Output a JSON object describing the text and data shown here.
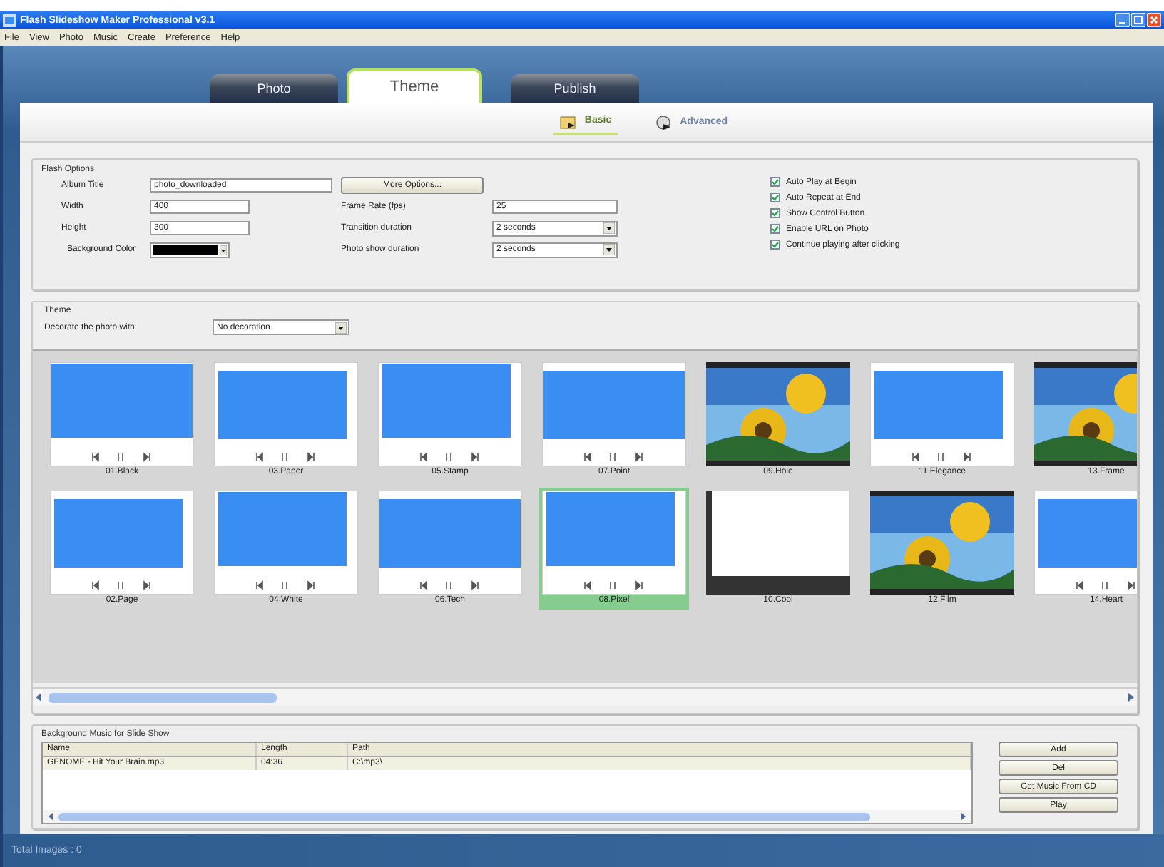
{
  "window": {
    "title": "Flash Slideshow Maker Professional v3.1"
  },
  "menu": [
    "File",
    "View",
    "Photo",
    "Music",
    "Create",
    "Preference",
    "Help"
  ],
  "tabs": [
    {
      "label": "Photo",
      "selected": false
    },
    {
      "label": "Theme",
      "selected": true
    },
    {
      "label": "Publish",
      "selected": false
    }
  ],
  "subtabs": [
    {
      "label": "Basic",
      "selected": true
    },
    {
      "label": "Advanced",
      "selected": false
    }
  ],
  "flash_options": {
    "title": "Flash Options",
    "album_title": {
      "label": "Album Title",
      "value": "photo_downloaded"
    },
    "width": {
      "label": "Width",
      "value": "400"
    },
    "height": {
      "label": "Height",
      "value": "300"
    },
    "background_color": {
      "label": "Background Color",
      "color": "#000000"
    },
    "more_options": "More Options...",
    "frame_rate": {
      "label": "Frame Rate (fps)",
      "value": "25"
    },
    "transition_duration": {
      "label": "Transition duration",
      "value": "2 seconds"
    },
    "photo_show_duration": {
      "label": "Photo show duration",
      "value": "2 seconds"
    },
    "checkboxes": [
      {
        "label": "Auto Play at Begin",
        "checked": true
      },
      {
        "label": "Auto Repeat at End",
        "checked": true
      },
      {
        "label": "Show Control Button",
        "checked": true
      },
      {
        "label": "Enable URL on Photo",
        "checked": true
      },
      {
        "label": "Continue playing after clicking",
        "checked": true
      }
    ]
  },
  "theme": {
    "title": "Theme",
    "decorate_label": "Decorate the photo with:",
    "decoration": "No decoration",
    "items": [
      {
        "label": "01.Black",
        "kind": "slide",
        "selected": false
      },
      {
        "label": "03.Paper",
        "kind": "slide",
        "selected": false
      },
      {
        "label": "05.Stamp",
        "kind": "slide",
        "selected": false
      },
      {
        "label": "07.Point",
        "kind": "slide",
        "selected": false
      },
      {
        "label": "09.Hole",
        "selected": false
      },
      {
        "label": "11.Elegance",
        "kind": "slide",
        "selected": false
      },
      {
        "label": "13.Frame",
        "selected": false
      },
      {
        "label": "02.Page",
        "kind": "slide",
        "selected": false
      },
      {
        "label": "04.White",
        "kind": "slide",
        "selected": false
      },
      {
        "label": "06.Tech",
        "kind": "slide",
        "selected": false
      },
      {
        "label": "08.Pixel",
        "kind": "slide",
        "selected": true
      },
      {
        "label": "10.Cool",
        "kind": "blank",
        "selected": false
      },
      {
        "label": "12.Film",
        "selected": false
      },
      {
        "label": "14.Heart",
        "kind": "slide",
        "selected": false
      }
    ]
  },
  "music": {
    "title": "Background Music for Slide Show",
    "columns": [
      "Name",
      "Length",
      "Path"
    ],
    "rows": [
      [
        "GENOME - Hit Your Brain.mp3",
        "04:36",
        "C:\\mp3\\"
      ]
    ],
    "buttons": [
      "Add",
      "Del",
      "Get Music From CD",
      "Play"
    ]
  },
  "status_bar": "Total Images : 0"
}
